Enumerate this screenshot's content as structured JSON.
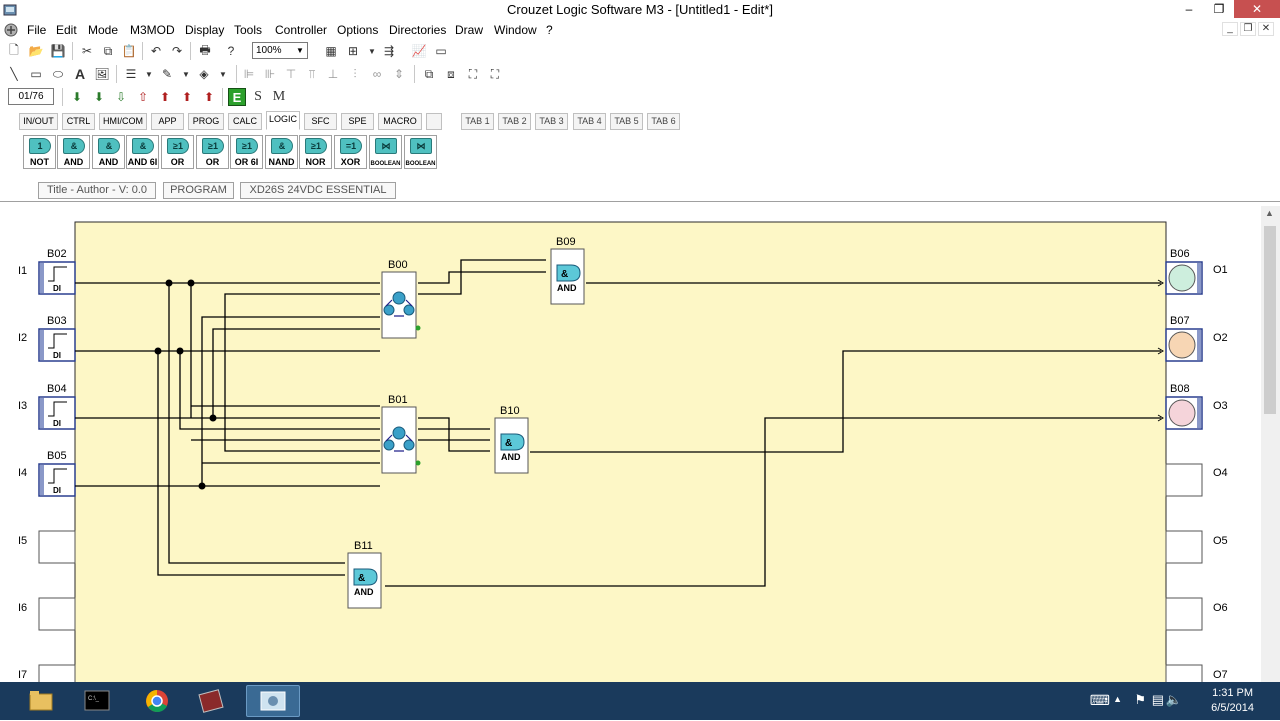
{
  "window": {
    "title": "Crouzet Logic Software M3 - [Untitled1 - Edit*]"
  },
  "menu": {
    "items": [
      "File",
      "Edit",
      "Mode",
      "M3MOD",
      "Display",
      "Tools",
      "Controller",
      "Options",
      "Directories",
      "Draw",
      "Window",
      "?"
    ]
  },
  "toolbar": {
    "zoom": "100%",
    "page_counter": "01/76",
    "mode_letters": [
      "E",
      "S",
      "M"
    ]
  },
  "function_tabs": [
    "IN/OUT",
    "CTRL",
    "HMI/COM",
    "APP",
    "PROG",
    "CALC",
    "LOGIC",
    "SFC",
    "SPE",
    "MACRO",
    "",
    "TAB 1",
    "TAB 2",
    "TAB 3",
    "TAB 4",
    "TAB 5",
    "TAB 6"
  ],
  "active_tab": "LOGIC",
  "palette": [
    {
      "symbol": "1",
      "label": "NOT"
    },
    {
      "symbol": "&",
      "label": "AND"
    },
    {
      "symbol": "&",
      "label": "AND"
    },
    {
      "symbol": "&",
      "label": "AND 6I"
    },
    {
      "symbol": "≥1",
      "label": "OR"
    },
    {
      "symbol": "≥1",
      "label": "OR"
    },
    {
      "symbol": "≥1",
      "label": "OR 6I"
    },
    {
      "symbol": "&",
      "label": "NAND"
    },
    {
      "symbol": "≥1",
      "label": "NOR"
    },
    {
      "symbol": "=1",
      "label": "XOR"
    },
    {
      "symbol": "",
      "label": "BOOLEAN"
    },
    {
      "symbol": "",
      "label": "BOOLEAN"
    }
  ],
  "info": {
    "title": "Title - Author - V: 0.0",
    "program": "PROGRAM",
    "controller": "XD26S 24VDC ESSENTIAL"
  },
  "diagram": {
    "inputs": [
      {
        "block": "B02",
        "label": "I1",
        "type": "DI"
      },
      {
        "block": "B03",
        "label": "I2",
        "type": "DI"
      },
      {
        "block": "B04",
        "label": "I3",
        "type": "DI"
      },
      {
        "block": "B05",
        "label": "I4",
        "type": "DI"
      },
      {
        "block": "",
        "label": "I5",
        "type": ""
      },
      {
        "block": "",
        "label": "I6",
        "type": ""
      },
      {
        "block": "",
        "label": "I7",
        "type": ""
      }
    ],
    "outputs": [
      {
        "block": "B06",
        "label": "O1",
        "color": "#cdeedd"
      },
      {
        "block": "B07",
        "label": "O2",
        "color": "#f7d6b4"
      },
      {
        "block": "B08",
        "label": "O3",
        "color": "#f5d4da"
      },
      {
        "block": "",
        "label": "O4",
        "color": ""
      },
      {
        "block": "",
        "label": "O5",
        "color": ""
      },
      {
        "block": "",
        "label": "O6",
        "color": ""
      },
      {
        "block": "",
        "label": "O7",
        "color": ""
      }
    ],
    "blocks": [
      {
        "id": "B00",
        "kind": "BOOLEAN"
      },
      {
        "id": "B01",
        "kind": "BOOLEAN"
      },
      {
        "id": "B09",
        "kind": "AND"
      },
      {
        "id": "B10",
        "kind": "AND"
      },
      {
        "id": "B11",
        "kind": "AND"
      }
    ]
  },
  "taskbar": {
    "time": "1:31 PM",
    "date": "6/5/2014"
  }
}
